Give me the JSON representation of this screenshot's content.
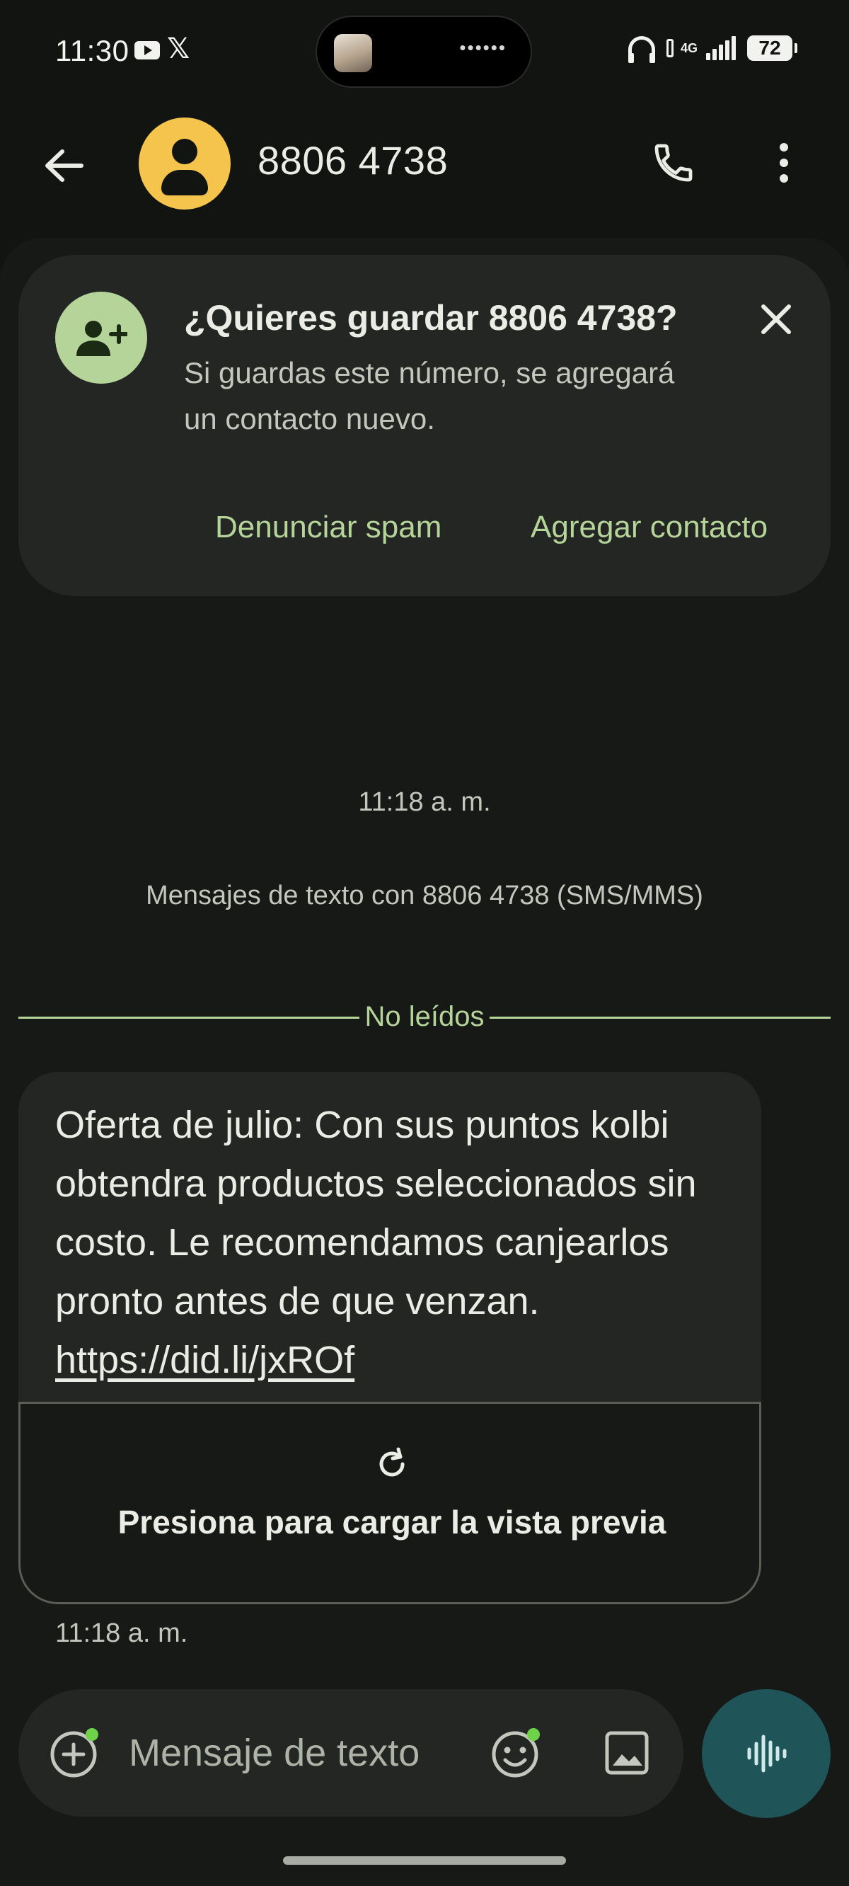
{
  "status_bar": {
    "time": "11:30",
    "network": "4G",
    "battery": "72",
    "notification_dots": "••••••"
  },
  "header": {
    "contact_name": "8806 4738"
  },
  "save_prompt": {
    "title": "¿Quieres guardar 8806 4738?",
    "body": "Si guardas este número, se agregará un contacto nuevo.",
    "spam_label": "Denunciar spam",
    "add_label": "Agregar contacto"
  },
  "conversation": {
    "thread_timestamp": "11:18 a. m.",
    "thread_info": "Mensajes de texto con 8806 4738 (SMS/MMS)",
    "unread_label": "No leídos",
    "message": {
      "text": "Oferta de julio: Con sus puntos kolbi obtendra productos seleccionados sin costo. Le recomendamos canjearlos pronto antes de que venzan.",
      "link": "https://did.li/jxROf",
      "preview_label": "Presiona para cargar la vista previa",
      "time": "11:18 a. m."
    }
  },
  "composer": {
    "placeholder": "Mensaje de texto"
  },
  "colors": {
    "background": "#121411",
    "surface": "#232622",
    "accent_green": "#b5d49a",
    "avatar_yellow": "#f5c44c",
    "voice_button": "#1f5458"
  }
}
